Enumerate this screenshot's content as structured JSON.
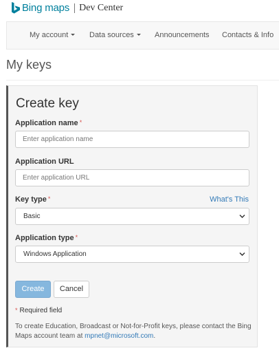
{
  "header": {
    "brand": "Bing maps",
    "product": "Dev Center"
  },
  "nav": {
    "items": [
      {
        "label": "My account",
        "dropdown": true
      },
      {
        "label": "Data sources",
        "dropdown": true
      },
      {
        "label": "Announcements",
        "dropdown": false
      },
      {
        "label": "Contacts & Info",
        "dropdown": false
      }
    ]
  },
  "page": {
    "title": "My keys"
  },
  "form": {
    "title": "Create key",
    "required_marker": "*",
    "app_name": {
      "label": "Application name",
      "placeholder": "Enter application name",
      "value": ""
    },
    "app_url": {
      "label": "Application URL",
      "placeholder": "Enter application URL",
      "value": ""
    },
    "key_type": {
      "label": "Key type",
      "help_link": "What's This",
      "selected": "Basic"
    },
    "app_type": {
      "label": "Application type",
      "selected": "Windows Application"
    },
    "create_label": "Create",
    "cancel_label": "Cancel",
    "required_note": "Required field",
    "info_before": "To create Education, Broadcast or Not-for-Profit keys, please contact the Bing Maps account team at ",
    "info_email": "mpnet@microsoft.com",
    "info_after": "."
  },
  "colors": {
    "brand": "#00809d",
    "primary_button": "#85b7de",
    "link": "#337ab7",
    "required": "#d9534f"
  }
}
